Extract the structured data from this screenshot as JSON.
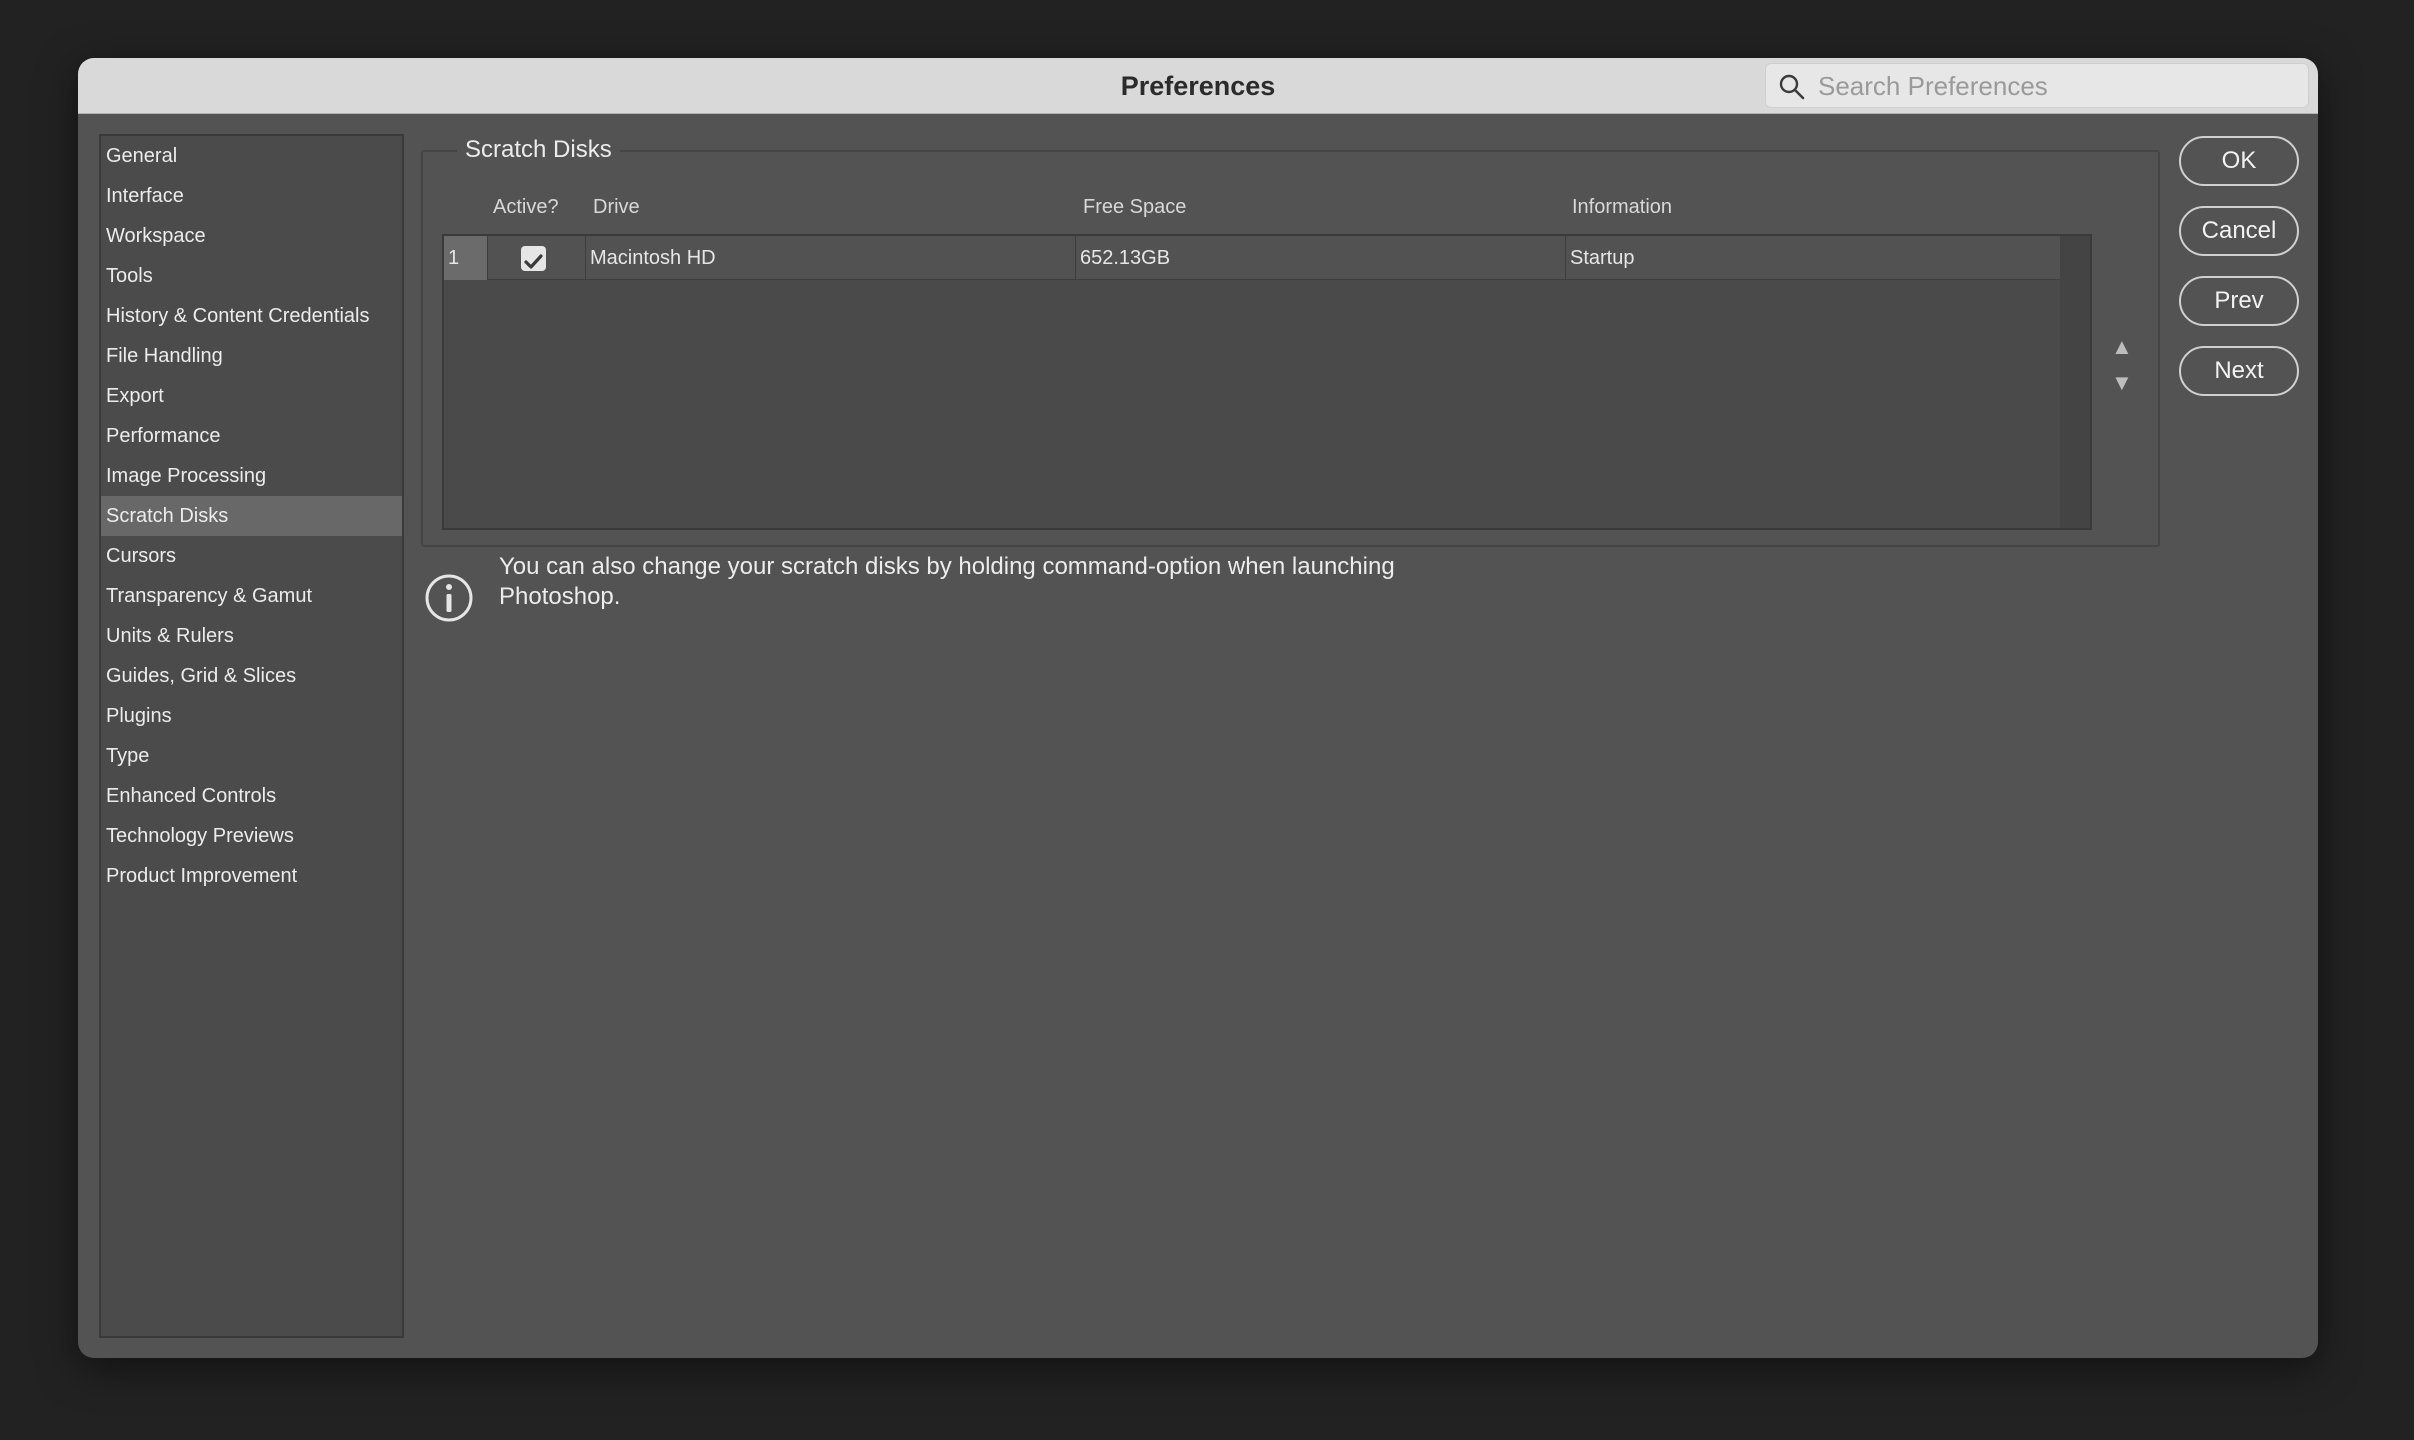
{
  "window": {
    "title": "Preferences"
  },
  "search": {
    "placeholder": "Search Preferences"
  },
  "sidebar": {
    "items": [
      {
        "label": "General"
      },
      {
        "label": "Interface"
      },
      {
        "label": "Workspace"
      },
      {
        "label": "Tools"
      },
      {
        "label": "History & Content Credentials"
      },
      {
        "label": "File Handling"
      },
      {
        "label": "Export"
      },
      {
        "label": "Performance"
      },
      {
        "label": "Image Processing"
      },
      {
        "label": "Scratch Disks"
      },
      {
        "label": "Cursors"
      },
      {
        "label": "Transparency & Gamut"
      },
      {
        "label": "Units & Rulers"
      },
      {
        "label": "Guides, Grid & Slices"
      },
      {
        "label": "Plugins"
      },
      {
        "label": "Type"
      },
      {
        "label": "Enhanced Controls"
      },
      {
        "label": "Technology Previews"
      },
      {
        "label": "Product Improvement"
      }
    ],
    "selected": "Scratch Disks"
  },
  "scratch_disks": {
    "group_label": "Scratch Disks",
    "columns": {
      "active": "Active?",
      "drive": "Drive",
      "free_space": "Free Space",
      "information": "Information"
    },
    "rows": [
      {
        "index": "1",
        "active": true,
        "drive": "Macintosh HD",
        "free_space": "652.13GB",
        "information": "Startup"
      }
    ]
  },
  "info": {
    "text": "You can also change your scratch disks by holding command-option when launching Photoshop."
  },
  "buttons": {
    "ok": "OK",
    "cancel": "Cancel",
    "prev": "Prev",
    "next": "Next"
  },
  "icons": {
    "search": "search-icon",
    "info": "info-icon",
    "checkbox": "checkmark-icon",
    "up": "arrow-up-icon",
    "down": "arrow-down-icon"
  }
}
